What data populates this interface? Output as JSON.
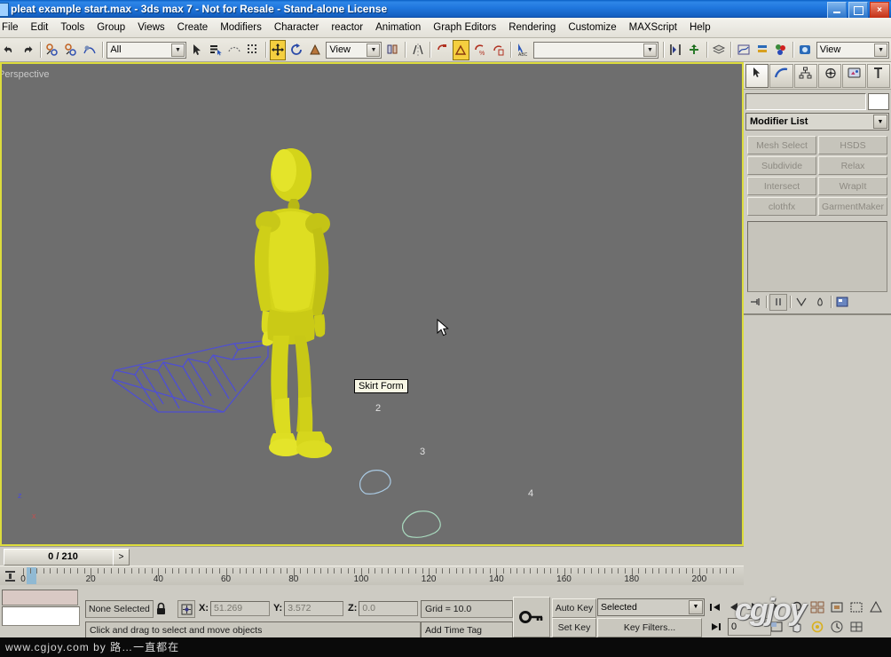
{
  "window": {
    "title": "pleat example start.max - 3ds max 7  - Not for Resale - Stand-alone License",
    "minimize_label": "",
    "maximize_label": "",
    "close_label": "×"
  },
  "menu": {
    "items": [
      {
        "label": "File"
      },
      {
        "label": "Edit"
      },
      {
        "label": "Tools"
      },
      {
        "label": "Group"
      },
      {
        "label": "Views"
      },
      {
        "label": "Create"
      },
      {
        "label": "Modifiers"
      },
      {
        "label": "Character"
      },
      {
        "label": "reactor"
      },
      {
        "label": "Animation"
      },
      {
        "label": "Graph Editors"
      },
      {
        "label": "Rendering"
      },
      {
        "label": "Customize"
      },
      {
        "label": "MAXScript"
      },
      {
        "label": "Help"
      }
    ]
  },
  "toolbar": {
    "undo": "undo-icon",
    "redo": "redo-icon",
    "select_link": "select-and-link-icon",
    "unlink": "unlink-selection-icon",
    "bind_space_warp": "bind-to-space-warp-icon",
    "selection_filter_value": "All",
    "select_object": "select-object-icon",
    "select_by_name": "select-by-name-icon",
    "select_region": "select-region-icon",
    "window_crossing": "window-crossing-icon",
    "select_move": "select-and-move-icon",
    "select_rotate": "select-and-rotate-icon",
    "select_scale": "select-and-scale-icon",
    "ref_coord_value": "View",
    "use_pivot": "use-pivot-point-center-icon",
    "mirror": "mirror-icon",
    "align": "align-icon",
    "named_selection_value": "",
    "array": "array-icon",
    "snap_toggle": "snaps-toggle-icon",
    "angle_snap": "angle-snap-toggle-icon",
    "percent_snap": "percent-snap-toggle-icon",
    "spinner_snap": "spinner-snap-toggle-icon",
    "layer_manager": "layer-manager-icon",
    "curve_editor": "curve-editor-icon",
    "schematic_view": "schematic-view-icon",
    "material_editor": "material-editor-icon",
    "render_scene": "render-scene-icon",
    "render_type_value": "View"
  },
  "viewport": {
    "label": "Perspective",
    "tooltip": "Skirt Form",
    "shape_labels": [
      "2",
      "3",
      "4"
    ],
    "axis_labels": {
      "x": "x",
      "y": "y",
      "z": "z"
    },
    "colors": {
      "background": "#6e6e6e",
      "active_border": "#dcdc3c",
      "mannequin": "#d6d61a",
      "pleat_wireframe": "#4a4ac8",
      "shape2": "#a8c8e0",
      "shape3": "#a8d8b8",
      "shape4": "#9cc4e4"
    }
  },
  "command_panel": {
    "tabs": [
      {
        "name": "create-tab",
        "icon": "arrow-cursor-icon",
        "active": true
      },
      {
        "name": "modify-tab",
        "icon": "curve-icon",
        "active": false
      },
      {
        "name": "hierarchy-tab",
        "icon": "hierarchy-icon",
        "active": false
      },
      {
        "name": "motion-tab",
        "icon": "wheel-icon",
        "active": false
      },
      {
        "name": "display-tab",
        "icon": "display-monitor-icon",
        "active": false
      },
      {
        "name": "utilities-tab",
        "icon": "hammer-icon",
        "active": false
      }
    ],
    "object_name": "",
    "modifier_list_label": "Modifier List",
    "modifier_buttons": [
      "Mesh Select",
      "HSDS",
      "Subdivide",
      "Relax",
      "Intersect",
      "WrapIt",
      "clothfx",
      "GarmentMaker"
    ],
    "stack_tools": [
      "pin-stack-icon",
      "show-end-result-icon",
      "make-unique-icon",
      "remove-modifier-icon",
      "configure-button-sets-icon"
    ]
  },
  "time_slider": {
    "current_frame_label": "0 / 210",
    "next_frame_label": ">"
  },
  "track_bar": {
    "tick_labels": [
      "0",
      "20",
      "40",
      "60",
      "80",
      "100",
      "120",
      "140",
      "160",
      "180",
      "200"
    ],
    "range_start": 0,
    "range_end": 210,
    "current_frame": 0
  },
  "status_bar": {
    "selection_text": "None Selected",
    "lock_icon": "lock-icon",
    "axis_constraint_icon": "absolute-relative-mode-icon",
    "coords": [
      {
        "axis": "X:",
        "value": "51.269"
      },
      {
        "axis": "Y:",
        "value": "3.572"
      },
      {
        "axis": "Z:",
        "value": "0.0"
      }
    ],
    "grid_text": "Grid = 10.0",
    "prompt_text": "Click and drag to select and move objects",
    "add_time_tag": "Add Time Tag",
    "key_mode_icon": "key-icon",
    "auto_key": "Auto Key",
    "set_key": "Set Key",
    "key_filter_mode": "Selected",
    "key_filters": "Key Filters...",
    "frame_field_value": "0",
    "nav_icons": [
      "go-to-start-icon",
      "previous-frame-icon",
      "play-animation-icon",
      "next-frame-icon",
      "go-to-end-icon",
      "zoom-icon",
      "zoom-all-icon",
      "zoom-extents-icon",
      "zoom-region-icon",
      "pan-icon",
      "arc-rotate-icon",
      "min-max-toggle-icon",
      "time-config-icon"
    ]
  },
  "watermark": {
    "viewport_logo": "cgjoy",
    "bottom_text": "www.cgjoy.com by 路…一直都在"
  }
}
